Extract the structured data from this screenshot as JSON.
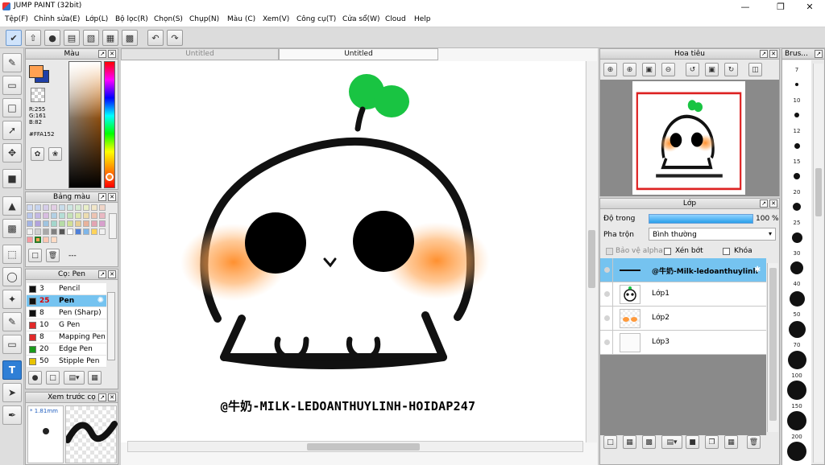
{
  "window": {
    "title": "JUMP PAINT (32bit)"
  },
  "menu": [
    "Tệp(F)",
    "Chỉnh sửa(E)",
    "Lớp(L)",
    "Bộ lọc(R)",
    "Chọn(S)",
    "Chụp(N)",
    "Màu (C)",
    "Xem(V)",
    "Công cụ(T)",
    "Cửa sổ(W)",
    "Cloud",
    "Help"
  ],
  "tabs": [
    "Untitled",
    "Untitled"
  ],
  "color_panel": {
    "title": "Màu",
    "r": "R:255",
    "g": "G:161",
    "b": "B:82",
    "hex": "#FFA152",
    "foreground": "#ffa152",
    "background": "#1f3fa8"
  },
  "palette_panel": {
    "title": "Bảng màu",
    "label": "---"
  },
  "pen_panel": {
    "title": "Cọ: Pen",
    "pens": [
      {
        "size": "3",
        "name": "Pencil",
        "color": "#111111"
      },
      {
        "size": "25",
        "name": "Pen",
        "color": "#111111",
        "selected": true
      },
      {
        "size": "8",
        "name": "Pen (Sharp)",
        "color": "#111111"
      },
      {
        "size": "10",
        "name": "G Pen",
        "color": "#e22a2a"
      },
      {
        "size": "8",
        "name": "Mapping Pen",
        "color": "#e22a2a"
      },
      {
        "size": "20",
        "name": "Edge Pen",
        "color": "#1a9a1a"
      },
      {
        "size": "50",
        "name": "Stipple Pen",
        "color": "#e8c300"
      }
    ]
  },
  "preview_panel": {
    "title": "Xem trước cọ",
    "size": "1.81mm"
  },
  "artwork": {
    "caption": "@牛奶-MILK-LEDOANTHUYLINH-HOIDAP247",
    "leaf_color": "#19c442",
    "blush_color": "#ff9a3c"
  },
  "navigator_panel": {
    "title": "Hoa tiêu"
  },
  "layer_panel": {
    "title": "Lớp",
    "opacity_label": "Độ trong",
    "opacity_value": "100 %",
    "opacity": 1.0,
    "blend_label": "Pha trộn",
    "blend_value": "Bình thường",
    "protect_alpha": "Bảo vệ alpha",
    "clip": "Xén bớt",
    "lock": "Khóa",
    "layers": [
      {
        "name": "@牛奶-Milk-ledoanthuylinh",
        "selected": true
      },
      {
        "name": "Lớp1"
      },
      {
        "name": "Lớp2"
      },
      {
        "name": "Lớp3"
      }
    ]
  },
  "brush_panel": {
    "title": "Brus...",
    "sizes": [
      "7",
      "10",
      "12",
      "15",
      "20",
      "25",
      "30",
      "40",
      "50",
      "70",
      "100",
      "150",
      "200"
    ]
  }
}
